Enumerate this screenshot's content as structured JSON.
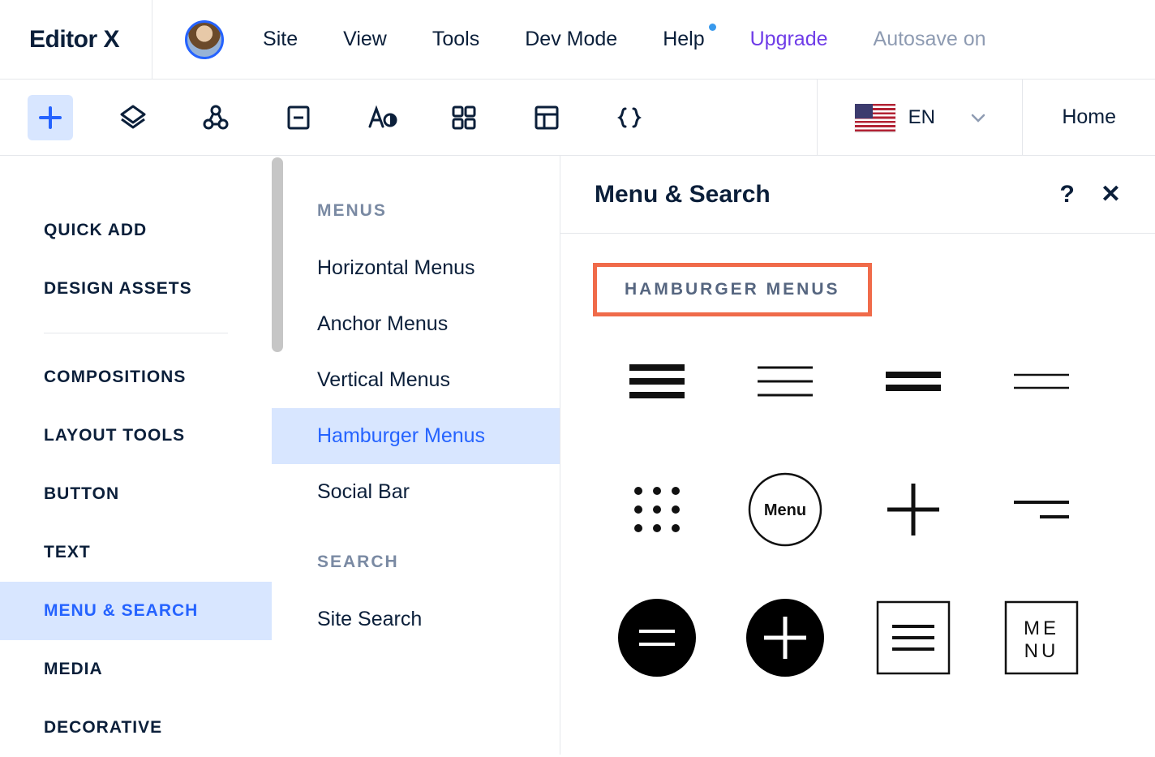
{
  "brand": "Editor X",
  "topmenu": {
    "site": "Site",
    "view": "View",
    "tools": "Tools",
    "devmode": "Dev Mode",
    "help": "Help",
    "upgrade": "Upgrade",
    "autosave": "Autosave on"
  },
  "toolbar": {
    "lang": "EN",
    "home": "Home"
  },
  "leftnav": {
    "quick_add": "QUICK ADD",
    "design_assets": "DESIGN ASSETS",
    "compositions": "COMPOSITIONS",
    "layout_tools": "LAYOUT TOOLS",
    "button": "BUTTON",
    "text": "TEXT",
    "menu_search": "MENU & SEARCH",
    "media": "MEDIA",
    "decorative": "DECORATIVE"
  },
  "midcol": {
    "menus_title": "MENUS",
    "horizontal": "Horizontal Menus",
    "anchor": "Anchor Menus",
    "vertical": "Vertical Menus",
    "hamburger": "Hamburger Menus",
    "social": "Social Bar",
    "search_title": "SEARCH",
    "site_search": "Site Search"
  },
  "rightpanel": {
    "title": "Menu & Search",
    "help_glyph": "?",
    "close_glyph": "✕",
    "section_label": "HAMBURGER MENUS",
    "thumb_menu_label": "Menu",
    "thumb_menu_box1": "ME",
    "thumb_menu_box2": "NU"
  }
}
